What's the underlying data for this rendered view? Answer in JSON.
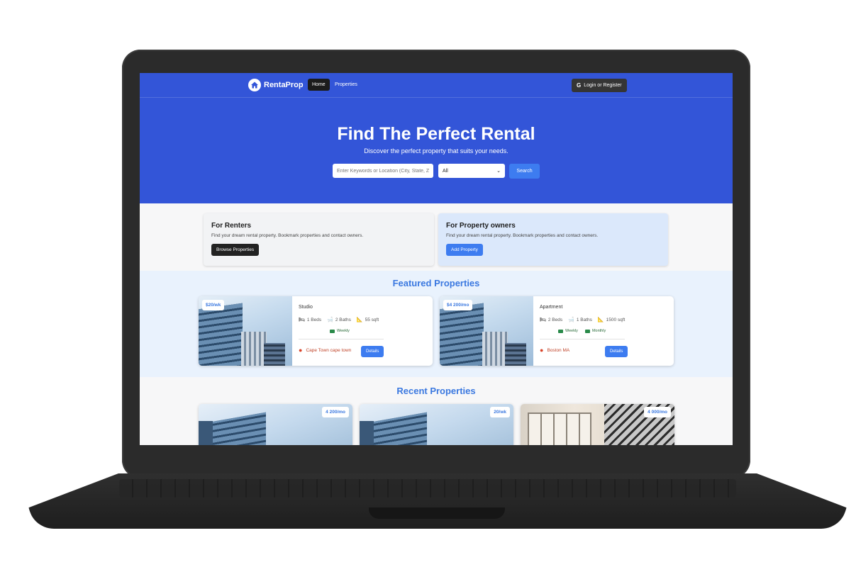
{
  "nav": {
    "brand": "RentaProp",
    "home": "Home",
    "properties": "Properties",
    "login": "Login or Register",
    "google_glyph": "G"
  },
  "hero": {
    "title": "Find The Perfect Rental",
    "subtitle": "Discover the perfect property that suits your needs.",
    "search_placeholder": "Enter Keywords or Location (City, State, Zip, etc)",
    "select_value": "All",
    "search_button": "Search"
  },
  "cta": {
    "renters": {
      "title": "For Renters",
      "text": "Find your dream rental property. Bookmark properties and contact owners.",
      "button": "Browse Properties"
    },
    "owners": {
      "title": "For Property owners",
      "text": "Find your dream rental property. Bookmark properties and contact owners.",
      "button": "Add Property"
    }
  },
  "featured": {
    "title": "Featured Properties",
    "cards": [
      {
        "price": "$20/wk",
        "type": "Studio",
        "beds": "1 Beds",
        "baths": "2 Baths",
        "sqft": "55 sqft",
        "terms": [
          "Weekly"
        ],
        "location": "Cape Town cape town",
        "details": "Details"
      },
      {
        "price": "$4 200/mo",
        "type": "Apartment",
        "beds": "2 Beds",
        "baths": "1 Baths",
        "sqft": "1500 sqft",
        "terms": [
          "Weekly",
          "Monthly"
        ],
        "location": "Boston MA",
        "details": "Details"
      }
    ]
  },
  "recent": {
    "title": "Recent Properties",
    "cards": [
      {
        "price": "4 200/mo"
      },
      {
        "price": "20/wk"
      },
      {
        "price": "4 000/mo"
      }
    ]
  },
  "colors": {
    "primary": "#3355d8",
    "accent": "#3d7cf0",
    "heading_blue": "#3a78e0",
    "location_red": "#c0442a"
  }
}
